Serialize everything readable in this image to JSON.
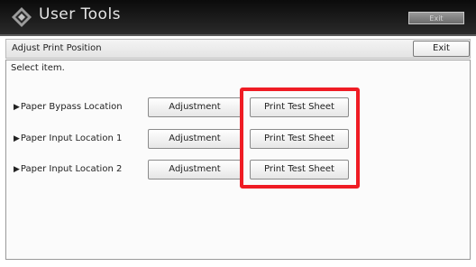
{
  "app": {
    "title": "User Tools",
    "top_exit_label": "Exit"
  },
  "header": {
    "title": "Adjust Print Position",
    "exit_label": "Exit"
  },
  "main": {
    "instruction": "Select item.",
    "rows": [
      {
        "label": "Paper Bypass Location",
        "adjust_label": "Adjustment",
        "print_label": "Print Test Sheet"
      },
      {
        "label": "Paper Input Location 1",
        "adjust_label": "Adjustment",
        "print_label": "Print Test Sheet"
      },
      {
        "label": "Paper Input Location 2",
        "adjust_label": "Adjustment",
        "print_label": "Print Test Sheet"
      }
    ]
  },
  "colors": {
    "highlight": "#ef1c24",
    "titlebar": "#111111"
  },
  "icons": {
    "logo": "user-tools-diamond-icon",
    "row_marker": "triangle-right-icon"
  }
}
